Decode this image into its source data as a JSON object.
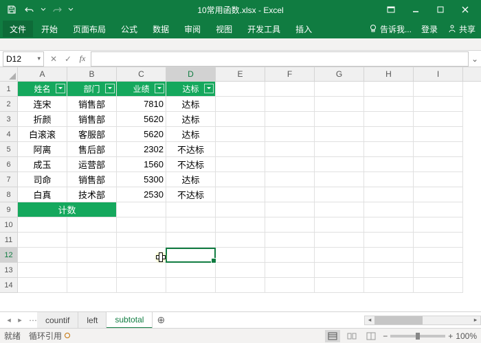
{
  "app": {
    "title": "10常用函数.xlsx - Excel"
  },
  "qat": {
    "save": "保存",
    "undo": "撤消",
    "redo": "恢复"
  },
  "window": {
    "min": "最小化",
    "max": "最大化",
    "close": "关闭"
  },
  "tabs": {
    "file": "文件",
    "home": "开始",
    "layout": "页面布局",
    "formulas": "公式",
    "data": "数据",
    "review": "审阅",
    "view": "视图",
    "dev": "开发工具",
    "insert": "插入"
  },
  "tell_me": "告诉我...",
  "signin": "登录",
  "share": "共享",
  "namebox": "D12",
  "formula": "",
  "columns": [
    "A",
    "B",
    "C",
    "D",
    "E",
    "F",
    "G",
    "H",
    "I"
  ],
  "headers": {
    "name": "姓名",
    "dept": "部门",
    "perf": "业绩",
    "target": "达标"
  },
  "data_rows": [
    {
      "name": "连宋",
      "dept": "销售部",
      "perf": "7810",
      "target": "达标"
    },
    {
      "name": "折颜",
      "dept": "销售部",
      "perf": "5620",
      "target": "达标"
    },
    {
      "name": "白滚滚",
      "dept": "客服部",
      "perf": "5620",
      "target": "达标"
    },
    {
      "name": "阿离",
      "dept": "售后部",
      "perf": "2302",
      "target": "不达标"
    },
    {
      "name": "成玉",
      "dept": "运营部",
      "perf": "1560",
      "target": "不达标"
    },
    {
      "name": "司命",
      "dept": "销售部",
      "perf": "5300",
      "target": "达标"
    },
    {
      "name": "白真",
      "dept": "技术部",
      "perf": "2530",
      "target": "不达标"
    }
  ],
  "count_label": "计数",
  "sheets": {
    "s1": "countif",
    "s2": "left",
    "s3": "subtotal"
  },
  "status": {
    "ready": "就绪",
    "circ": "循环引用",
    "zoom": "100%"
  },
  "chart_data": {
    "type": "table",
    "columns": [
      "姓名",
      "部门",
      "业绩",
      "达标"
    ],
    "rows": [
      [
        "连宋",
        "销售部",
        7810,
        "达标"
      ],
      [
        "折颜",
        "销售部",
        5620,
        "达标"
      ],
      [
        "白滚滚",
        "客服部",
        5620,
        "达标"
      ],
      [
        "阿离",
        "售后部",
        2302,
        "不达标"
      ],
      [
        "成玉",
        "运营部",
        1560,
        "不达标"
      ],
      [
        "司命",
        "销售部",
        5300,
        "达标"
      ],
      [
        "白真",
        "技术部",
        2530,
        "不达标"
      ]
    ]
  }
}
